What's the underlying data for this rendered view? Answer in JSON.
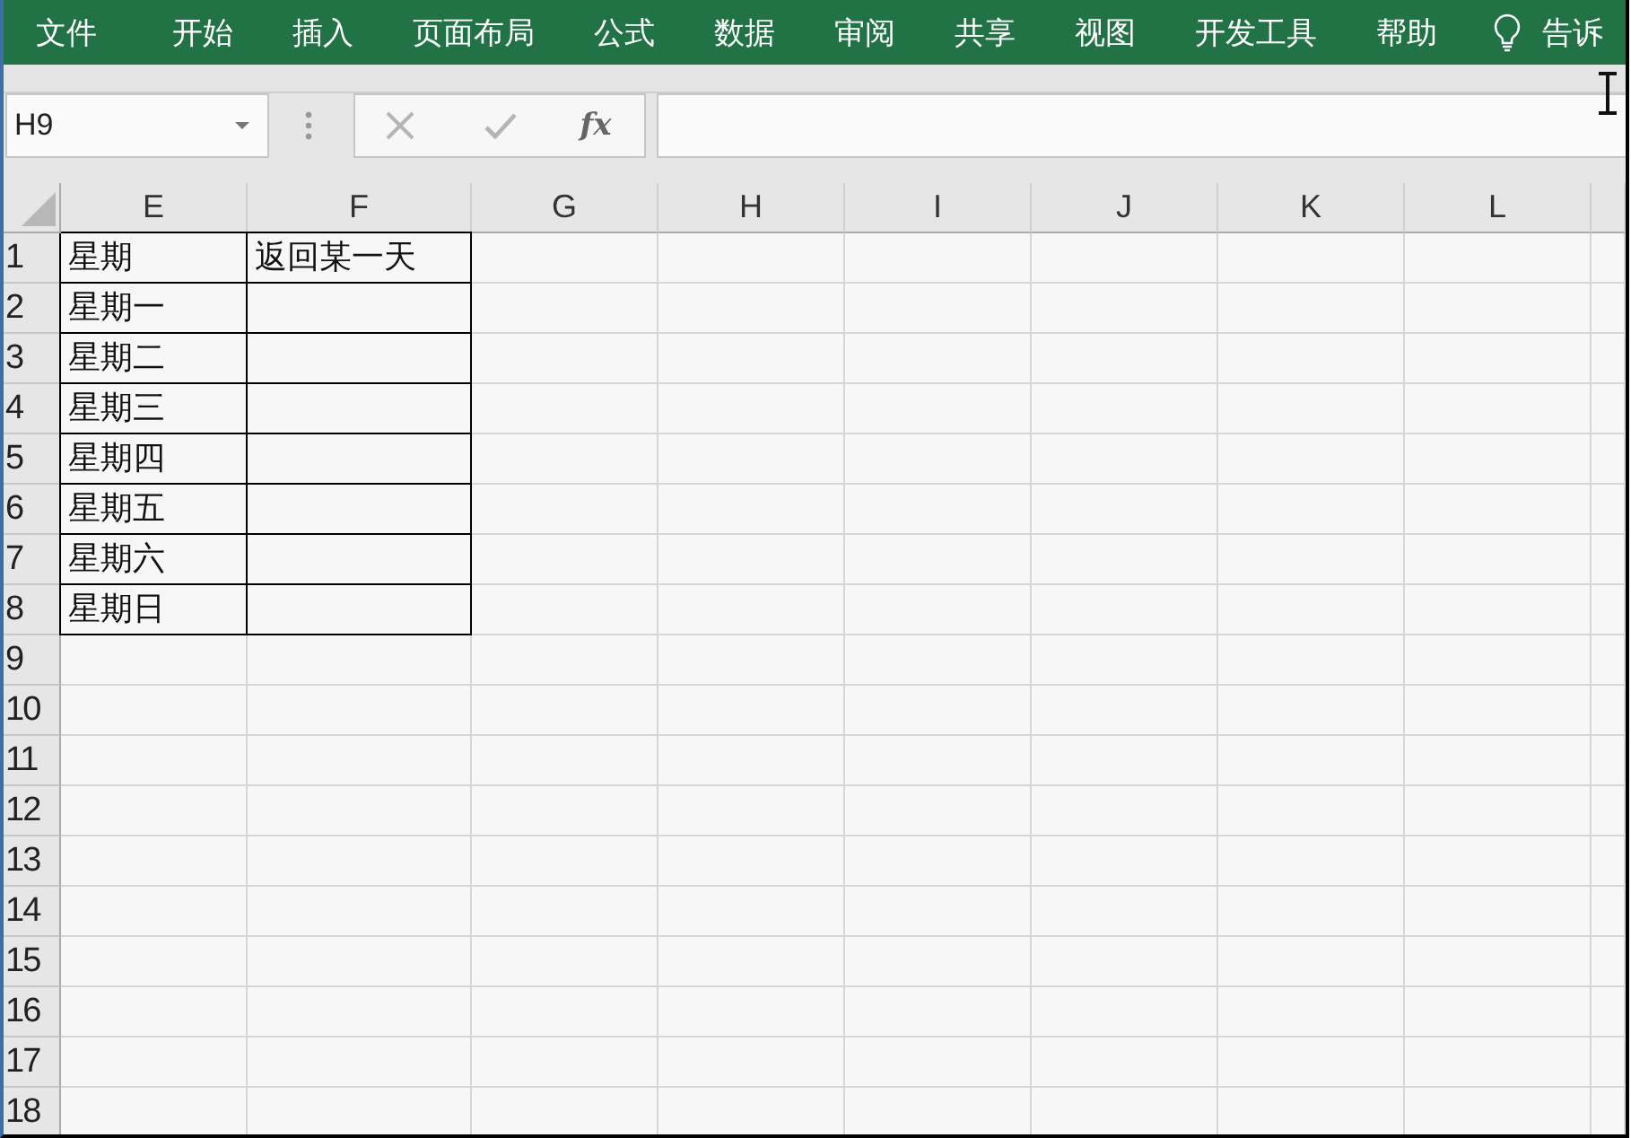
{
  "ribbon": {
    "tabs": [
      {
        "label": "文件",
        "selected": false
      },
      {
        "label": "开始",
        "selected": false
      },
      {
        "label": "插入",
        "selected": false
      },
      {
        "label": "页面布局",
        "selected": false
      },
      {
        "label": "公式",
        "selected": false
      },
      {
        "label": "数据",
        "selected": false
      },
      {
        "label": "审阅",
        "selected": false
      },
      {
        "label": "共享",
        "selected": false
      },
      {
        "label": "视图",
        "selected": false
      },
      {
        "label": "开发工具",
        "selected": false
      },
      {
        "label": "帮助",
        "selected": false
      }
    ],
    "tell_me": "告诉"
  },
  "formula_bar": {
    "name_box": "H9",
    "function_label": "fx"
  },
  "sheet": {
    "columns": [
      "E",
      "F",
      "G",
      "H",
      "I",
      "J",
      "K",
      "L"
    ],
    "rows": [
      {
        "header": "1",
        "cells": [
          {
            "text": "星期",
            "bordered": true
          },
          {
            "text": "返回某一天",
            "bordered": true
          }
        ]
      },
      {
        "header": "2",
        "cells": [
          {
            "text": "星期一",
            "bordered": true
          },
          {
            "bordered": true
          }
        ]
      },
      {
        "header": "3",
        "cells": [
          {
            "text": "星期二",
            "bordered": true
          },
          {
            "bordered": true
          }
        ]
      },
      {
        "header": "4",
        "cells": [
          {
            "text": "星期三",
            "bordered": true
          },
          {
            "bordered": true
          }
        ]
      },
      {
        "header": "5",
        "cells": [
          {
            "text": "星期四",
            "bordered": true
          },
          {
            "bordered": true
          }
        ]
      },
      {
        "header": "6",
        "cells": [
          {
            "text": "星期五",
            "bordered": true
          },
          {
            "bordered": true
          }
        ]
      },
      {
        "header": "7",
        "cells": [
          {
            "text": "星期六",
            "bordered": true
          },
          {
            "bordered": true
          }
        ]
      },
      {
        "header": "8",
        "cells": [
          {
            "text": "星期日",
            "bordered": true
          },
          {
            "bordered": true
          }
        ]
      },
      {
        "header": "9"
      },
      {
        "header": "10"
      },
      {
        "header": "11"
      },
      {
        "header": "12"
      },
      {
        "header": "13"
      },
      {
        "header": "14"
      },
      {
        "header": "15"
      },
      {
        "header": "16"
      },
      {
        "header": "17"
      },
      {
        "header": "18"
      }
    ]
  }
}
